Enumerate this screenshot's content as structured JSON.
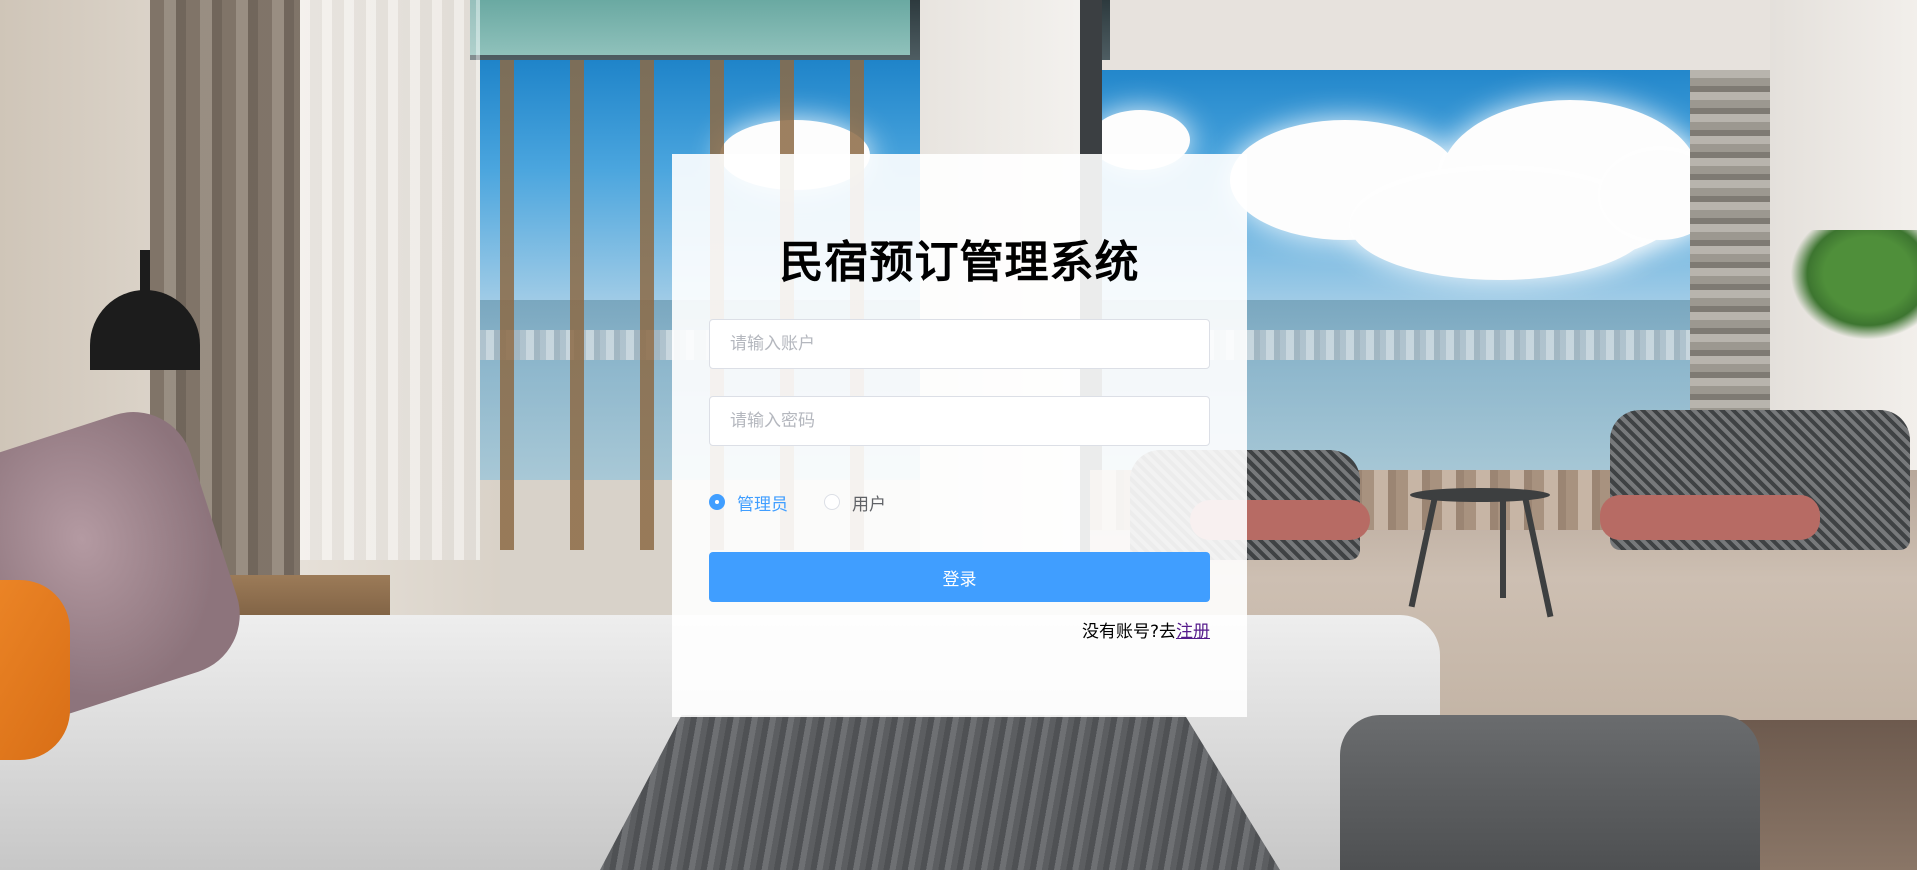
{
  "app": {
    "title": "民宿预订管理系统"
  },
  "form": {
    "account_placeholder": "请输入账户",
    "account_value": "",
    "password_placeholder": "请输入密码",
    "password_value": "",
    "roles": [
      {
        "label": "管理员",
        "checked": true
      },
      {
        "label": "用户",
        "checked": false
      }
    ],
    "login_label": "登录",
    "register_prompt": "没有账号?去",
    "register_link": "注册"
  },
  "colors": {
    "primary": "#409eff",
    "link": "#551a8b",
    "panel_bg": "rgba(255,255,255,0.9)"
  },
  "icons": [
    "radio-checked-icon",
    "radio-unchecked-icon"
  ]
}
